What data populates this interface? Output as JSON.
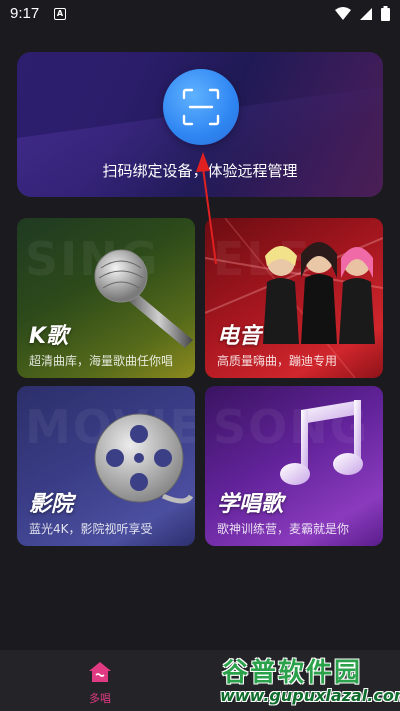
{
  "status_bar": {
    "time": "9:17",
    "app_icon": "A"
  },
  "scan": {
    "label": "扫码绑定设备，体验远程管理",
    "icon": "scan-frame-icon"
  },
  "tiles": [
    {
      "id": "karaoke",
      "bg_word": "SING",
      "title": "K歌",
      "subtitle": "超清曲库，海量歌曲任你唱",
      "icon": "microphone-icon"
    },
    {
      "id": "electronic",
      "bg_word": "ELE",
      "title": "电音",
      "subtitle": "高质量嗨曲，蹦迪专用",
      "icon": "performers-image"
    },
    {
      "id": "cinema",
      "bg_word": "MOVIE",
      "title": "影院",
      "subtitle": "蓝光4K，影院视听享受",
      "icon": "film-reel-icon"
    },
    {
      "id": "learn",
      "bg_word": "SONG",
      "title": "学唱歌",
      "subtitle": "歌神训练营，麦霸就是你",
      "icon": "music-note-icon"
    }
  ],
  "bottom_nav": {
    "items": [
      {
        "label": "多唱",
        "icon": "home-icon",
        "active": true
      }
    ]
  },
  "watermark": {
    "title": "谷普软件园",
    "url": "www.gupuxlazal.com"
  },
  "colors": {
    "background": "#1b1b1f",
    "accent": "#e03a83",
    "scan_blue": "#2f86f2"
  }
}
